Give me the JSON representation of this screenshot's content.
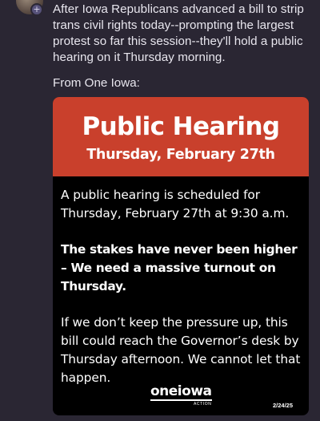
{
  "post": {
    "text": "After Iowa Republicans advanced a bill to strip trans civil rights today--prompting the largest protest so far this session--they'll hold a public hearing on it Thursday morning.",
    "source_line": "From One Iowa:",
    "avatar_badge": "+"
  },
  "card": {
    "title": "Public Hearing",
    "subtitle": "Thursday, February 27th",
    "paragraphs": [
      "A public hearing is scheduled for Thursday, February 27th at 9:30 a.m.",
      "The stakes have never been higher – We need a massive turnout on Thursday.",
      "If we don’t keep the pressure up, this bill could reach the Governor’s desk by Thursday afternoon. We cannot let that happen."
    ],
    "logo": "oneiowa",
    "logo_sub": "ACTION",
    "date": "2/24/25",
    "header_color": "#c9402c",
    "background_color": "#000000"
  }
}
